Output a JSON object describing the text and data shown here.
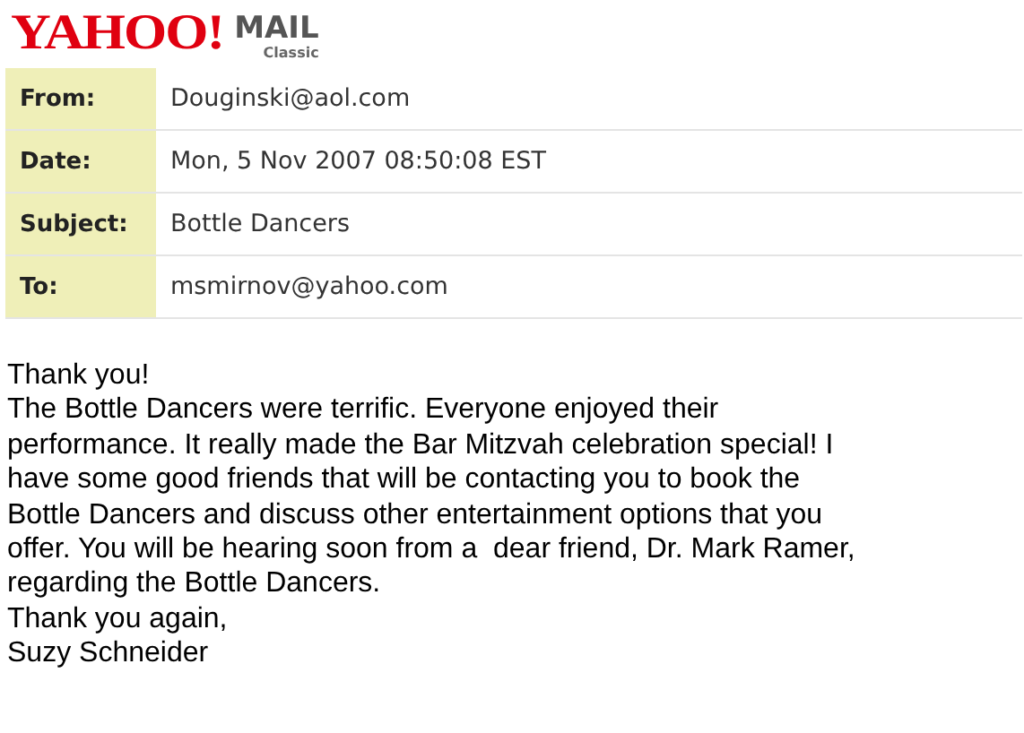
{
  "logo": {
    "brand": "YAHOO!",
    "product": "MAIL",
    "edition": "Classic"
  },
  "headers": [
    {
      "label": "From:",
      "value": "Douginski@aol.com"
    },
    {
      "label": "Date:",
      "value": "Mon, 5 Nov 2007 08:50:08 EST"
    },
    {
      "label": "Subject:",
      "value": "Bottle Dancers"
    },
    {
      "label": "To:",
      "value": "msmirnov@yahoo.com"
    }
  ],
  "body_lines": [
    "Thank you!",
    "The Bottle Dancers were terrific. Everyone enjoyed their",
    "performance. It really made the Bar Mitzvah celebration special! I",
    "have some good friends that will be contacting you to book the",
    "Bottle Dancers and discuss other entertainment options that you",
    "offer. You will be hearing soon from a  dear friend, Dr. Mark Ramer,",
    "regarding the Bottle Dancers.",
    "Thank you again,",
    "Suzy Schneider"
  ]
}
